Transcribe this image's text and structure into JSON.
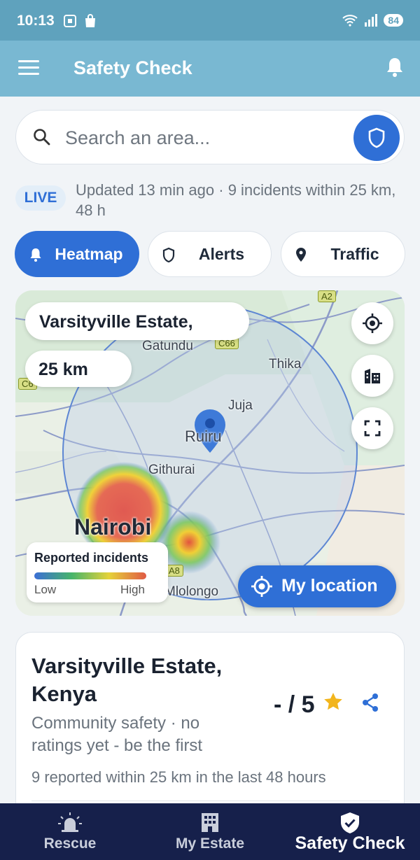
{
  "status_bar": {
    "time": "10:13",
    "battery": "84"
  },
  "app_bar": {
    "title": "Safety Check"
  },
  "search": {
    "placeholder": "Search an area..."
  },
  "live": {
    "badge": "LIVE",
    "text": "Updated 13 min ago · 9 incidents within 25 km, 48 h"
  },
  "chips": [
    {
      "label": "Heatmap",
      "icon": "bell-icon",
      "active": true
    },
    {
      "label": "Alerts",
      "icon": "shield-icon",
      "active": false
    },
    {
      "label": "Traffic",
      "icon": "pin-icon",
      "active": false
    }
  ],
  "map": {
    "location_label": "Varsityville Estate,",
    "radius_label": "25 km",
    "places": [
      "Gatundu",
      "Thika",
      "Juja",
      "Ruiru",
      "Githurai",
      "Nairobi",
      "Mlolongo"
    ],
    "road_tags": [
      "A2",
      "C66",
      "C6",
      "A8"
    ],
    "legend": {
      "title": "Reported incidents",
      "low": "Low",
      "high": "High"
    },
    "my_location_label": "My location"
  },
  "card": {
    "place": "Varsityville Estate, Kenya",
    "rating": "- / 5",
    "community": "Community safety · no ratings yet - be the first",
    "reported": "9 reported within 25 km in the last 48 hours"
  },
  "nav": [
    {
      "label": "Rescue",
      "icon": "siren-icon",
      "active": false
    },
    {
      "label": "My Estate",
      "icon": "building-icon",
      "active": false
    },
    {
      "label": "Safety Check",
      "icon": "shield-check-icon",
      "active": true
    }
  ],
  "colors": {
    "primary": "#2f6fd6",
    "app_bar": "#79b8d2",
    "status_bar": "#5fa2bd",
    "nav_bg": "#16204b",
    "star": "#f2b51d"
  }
}
